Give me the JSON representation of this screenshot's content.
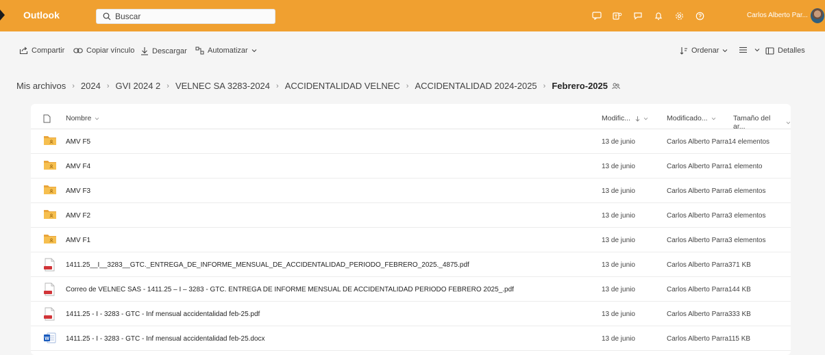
{
  "topbar": {
    "app_name": "Outlook",
    "search_placeholder": "Buscar",
    "user_name": "Carlos Alberto Par...",
    "accent": "#f0a030"
  },
  "commands": {
    "share": "Compartir",
    "copy_link": "Copiar vínculo",
    "download": "Descargar",
    "automate": "Automatizar",
    "sort": "Ordenar",
    "details": "Detalles"
  },
  "breadcrumb": [
    "Mis archivos",
    "2024",
    "GVI 2024 2",
    "VELNEC SA 3283-2024",
    "ACCIDENTALIDAD VELNEC",
    "ACCIDENTALIDAD 2024-2025"
  ],
  "breadcrumb_current": "Febrero-2025",
  "columns": {
    "name": "Nombre",
    "modified": "Modific...",
    "modified_by": "Modificado...",
    "size": "Tamaño del ar..."
  },
  "files": [
    {
      "icon": "shared-folder-icon",
      "name": "AMV F5",
      "modified": "13 de junio",
      "modified_by": "Carlos Alberto Parra",
      "size": "14 elementos"
    },
    {
      "icon": "shared-folder-icon",
      "name": "AMV F4",
      "modified": "13 de junio",
      "modified_by": "Carlos Alberto Parra",
      "size": "1 elemento"
    },
    {
      "icon": "shared-folder-icon",
      "name": "AMV F3",
      "modified": "13 de junio",
      "modified_by": "Carlos Alberto Parra",
      "size": "6 elementos"
    },
    {
      "icon": "shared-folder-icon",
      "name": "AMV F2",
      "modified": "13 de junio",
      "modified_by": "Carlos Alberto Parra",
      "size": "3 elementos"
    },
    {
      "icon": "shared-folder-icon",
      "name": "AMV F1",
      "modified": "13 de junio",
      "modified_by": "Carlos Alberto Parra",
      "size": "3 elementos"
    },
    {
      "icon": "pdf-file-icon",
      "name": "1411.25__I__3283__GTC._ENTREGA_DE_INFORME_MENSUAL_DE_ACCIDENTALIDAD_PERIODO_FEBRERO_2025._4875.pdf",
      "modified": "13 de junio",
      "modified_by": "Carlos Alberto Parra",
      "size": "371 KB"
    },
    {
      "icon": "pdf-file-icon",
      "name": "Correo de VELNEC SAS - 1411.25 – I – 3283 - GTC. ENTREGA DE INFORME MENSUAL DE ACCIDENTALIDAD PERIODO FEBRERO 2025_.pdf",
      "modified": "13 de junio",
      "modified_by": "Carlos Alberto Parra",
      "size": "144 KB"
    },
    {
      "icon": "pdf-file-icon",
      "name": "1411.25 - I - 3283 - GTC - Inf mensual accidentalidad feb-25.pdf",
      "modified": "13 de junio",
      "modified_by": "Carlos Alberto Parra",
      "size": "333 KB"
    },
    {
      "icon": "word-file-icon",
      "name": "1411.25 - I - 3283 - GTC - Inf mensual accidentalidad feb-25.docx",
      "modified": "13 de junio",
      "modified_by": "Carlos Alberto Parra",
      "size": "115 KB"
    }
  ]
}
